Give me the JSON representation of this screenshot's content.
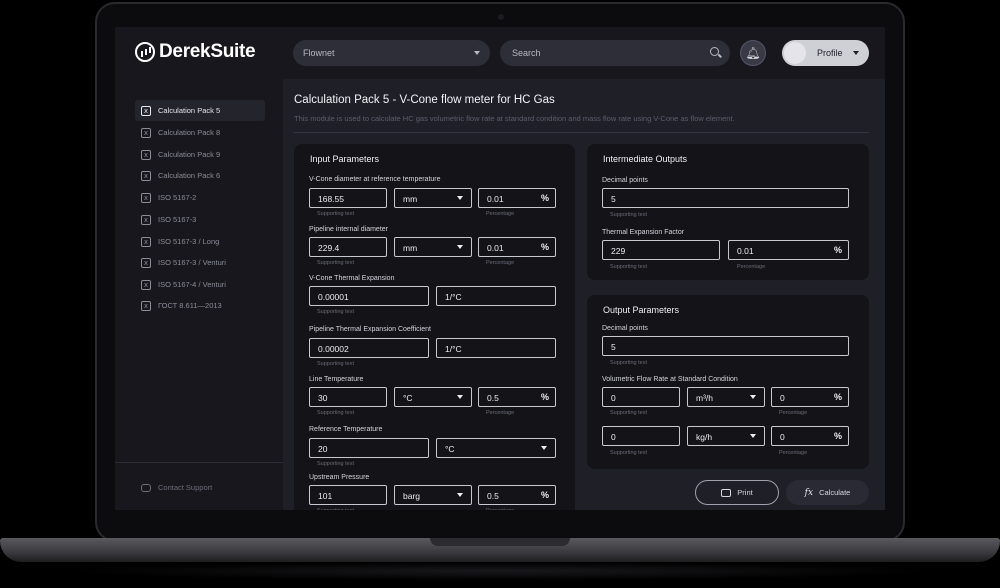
{
  "header": {
    "logo": "DerekSuite",
    "module_select": "Flownet",
    "search_placeholder": "Search",
    "profile_label": "Profile"
  },
  "sidebar": {
    "items": [
      {
        "label": "Calculation Pack 5",
        "active": true
      },
      {
        "label": "Calculation Pack 8"
      },
      {
        "label": "Calculation Pack 9"
      },
      {
        "label": "Calculation Pack 6"
      },
      {
        "label": "ISO 5167-2"
      },
      {
        "label": "ISO 5167-3"
      },
      {
        "label": "ISO 5167-3 / Long"
      },
      {
        "label": "ISO 5167-3 / Venturi"
      },
      {
        "label": "ISO 5167-4 / Venturi"
      },
      {
        "label": "ГОСТ 8.611—2013"
      }
    ],
    "support": "Contact Support"
  },
  "page": {
    "title": "Calculation Pack 5 - V-Cone flow meter for HC Gas",
    "description": "This module is used to calculate HC gas volumetric flow rate at standard condition and mass flow rate using V-Cone as flow element."
  },
  "input": {
    "title": "Input Parameters",
    "supporting": "Supporting text",
    "percentage": "Percentage",
    "pct_symbol": "%",
    "vcone": {
      "label": "V-Cone diameter at reference temperature",
      "value": "168.55",
      "unit": "mm",
      "pct": "0.01"
    },
    "pipe": {
      "label": "Pipeline internal diameter",
      "value": "229.4",
      "unit": "mm",
      "pct": "0.01"
    },
    "vcone_exp": {
      "label": "V-Cone Thermal Expansion",
      "value": "0.00001",
      "unit": "1/°C"
    },
    "pipe_exp": {
      "label": "Pipeline Thermal Expansion Coefficient",
      "value": "0.00002",
      "unit": "1/°C"
    },
    "line_temp": {
      "label": "Line Temperature",
      "value": "30",
      "unit": "°C",
      "pct": "0.5"
    },
    "ref_temp": {
      "label": "Reference Temperature",
      "value": "20",
      "unit": "°C"
    },
    "upstream": {
      "label": "Upstream Pressure",
      "value": "101",
      "unit": "barg",
      "pct": "0.5"
    }
  },
  "intermediate": {
    "title": "Intermediate Outputs",
    "decimal": {
      "label": "Decimal points",
      "value": "5"
    },
    "thermal": {
      "label": "Thermal Expansion Factor",
      "value": "229",
      "pct": "0.01"
    },
    "supporting": "Supporting text",
    "percentage": "Percentage",
    "pct_symbol": "%"
  },
  "output": {
    "title": "Output Parameters",
    "decimal": {
      "label": "Decimal points",
      "value": "5"
    },
    "flow": {
      "label": "Volumetric Flow Rate at Standard Condition",
      "value": "0",
      "unit": "m³/h",
      "pct": "0"
    },
    "mass": {
      "value": "0",
      "unit": "kg/h",
      "pct": "0"
    },
    "supporting": "Supporting text",
    "percentage": "Percentage",
    "pct_symbol": "%"
  },
  "actions": {
    "print": "Print",
    "calculate": "Calculate"
  }
}
